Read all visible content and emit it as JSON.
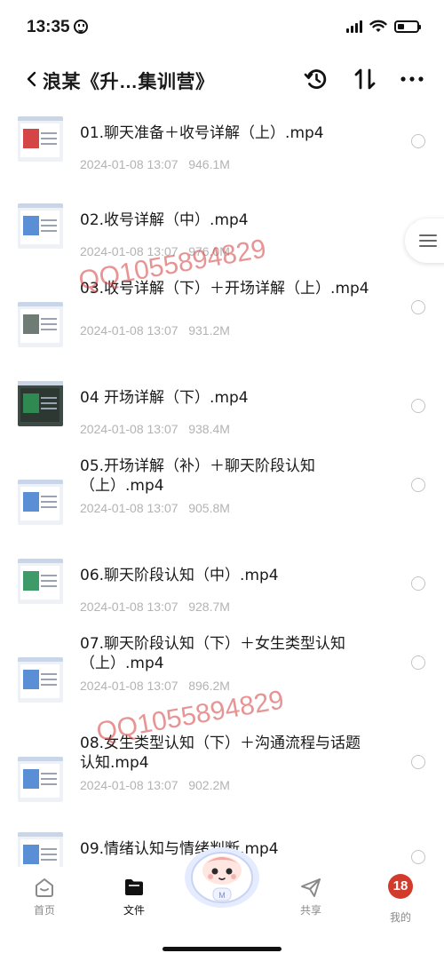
{
  "status_bar": {
    "time": "13:35",
    "icons": [
      "smiley-icon",
      "signal-icon",
      "wifi-icon",
      "battery-icon"
    ],
    "battery_level": 0.35
  },
  "nav": {
    "title": "浪某《升…集训营》",
    "icons": [
      "back-icon",
      "history-icon",
      "sort-icon",
      "more-icon"
    ]
  },
  "files": [
    {
      "name": "01.聊天准备＋收号详解（上）.mp4",
      "date": "2024-01-08 13:07",
      "size": "946.1M",
      "thumb": "red"
    },
    {
      "name": "02.收号详解（中）.mp4",
      "date": "2024-01-08 13:07",
      "size": "976.0M",
      "thumb": "light"
    },
    {
      "name": "03.收号详解（下）＋开场详解（上）.mp4",
      "date": "2024-01-08 13:07",
      "size": "931.2M",
      "thumb": "gray"
    },
    {
      "name": "04 开场详解（下）.mp4",
      "date": "2024-01-08 13:07",
      "size": "938.4M",
      "thumb": "dark"
    },
    {
      "name": "05.开场详解（补）＋聊天阶段认知（上）.mp4",
      "date": "2024-01-08 13:07",
      "size": "905.8M",
      "thumb": "light"
    },
    {
      "name": "06.聊天阶段认知（中）.mp4",
      "date": "2024-01-08 13:07",
      "size": "928.7M",
      "thumb": "green"
    },
    {
      "name": "07.聊天阶段认知（下）＋女生类型认知（上）.mp4",
      "date": "2024-01-08 13:07",
      "size": "896.2M",
      "thumb": "light"
    },
    {
      "name": "08.女生类型认知（下）＋沟通流程与话题认知.mp4",
      "date": "2024-01-08 13:07",
      "size": "902.2M",
      "thumb": "light"
    },
    {
      "name": "09.情绪认知与情绪判断.mp4",
      "date": "",
      "size": "",
      "thumb": "light"
    }
  ],
  "watermark": {
    "text": "QQ1055894829",
    "color": "#d63c3c"
  },
  "tabs": [
    {
      "label": "首页",
      "icon": "home-icon",
      "active": false
    },
    {
      "label": "文件",
      "icon": "folder-icon",
      "active": true
    },
    {
      "label": "",
      "icon": "mascot-icon",
      "active": false
    },
    {
      "label": "共享",
      "icon": "share-icon",
      "active": false
    },
    {
      "label": "我的",
      "icon": "profile-icon",
      "active": false
    }
  ],
  "profile_badge": "18"
}
